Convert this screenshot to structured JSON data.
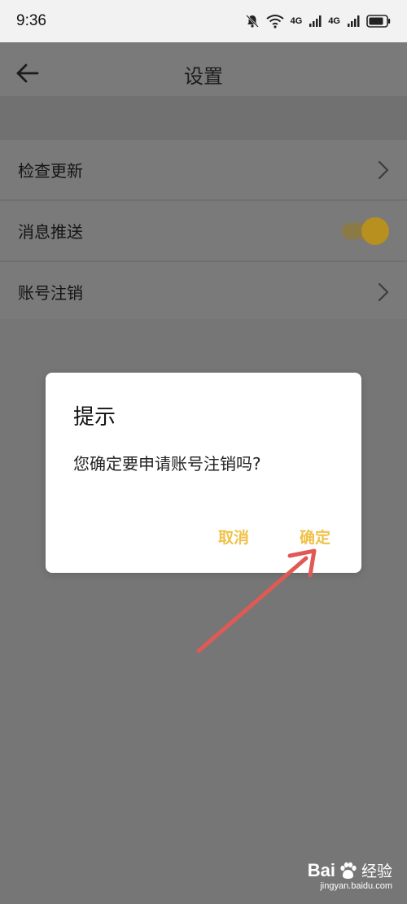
{
  "status_bar": {
    "time": "9:36",
    "net1": "4G",
    "net2": "4G",
    "icons": [
      "bell-muted-icon",
      "wifi-icon",
      "signal-icon",
      "signal-icon",
      "battery-icon"
    ]
  },
  "header": {
    "title": "设置",
    "back_icon": "arrow-left-icon"
  },
  "settings": {
    "items": [
      {
        "label": "检查更新",
        "control": "chevron"
      },
      {
        "label": "消息推送",
        "control": "toggle",
        "toggle_on": true
      },
      {
        "label": "账号注销",
        "control": "chevron"
      }
    ]
  },
  "dialog": {
    "title": "提示",
    "message": "您确定要申请账号注销吗?",
    "cancel_label": "取消",
    "confirm_label": "确定"
  },
  "annotation": {
    "color": "#e05a55"
  },
  "watermark": {
    "brand_left": "Bai",
    "brand_right": "经验",
    "domain": "jingyan.baidu.com"
  },
  "colors": {
    "accent": "#f0c24a",
    "overlay": "#7a7a7a"
  }
}
